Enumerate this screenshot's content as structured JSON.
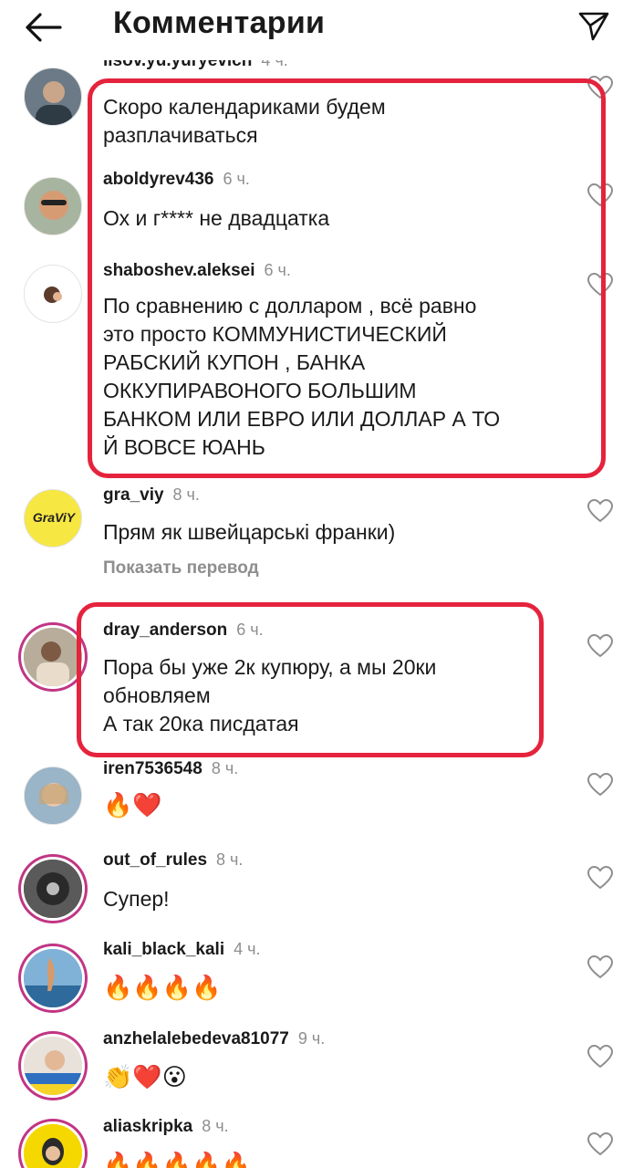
{
  "header": {
    "title": "Комментарии"
  },
  "cut_comment": {
    "username": "lisov.yu.yuryevich",
    "time": "4 ч.",
    "text": "Скоро календариками будем\nразплачиваться"
  },
  "comments": [
    {
      "username": "aboldyrev436",
      "time": "6 ч.",
      "text": "Ох и г**** не двадцатка"
    },
    {
      "username": "shaboshev.aleksei",
      "time": "6 ч.",
      "text": "По сравнению с долларом , всё равно\nэто просто КОММУНИСТИЧЕСКИЙ\nРАБСКИЙ КУПОН , БАНКА\nОККУПИРАВОНОГО БОЛЬШИМ\nБАНКОМ ИЛИ ЕВРО ИЛИ ДОЛЛАР А ТО\nЙ ВОВСЕ ЮАНЬ"
    },
    {
      "username": "gra_viy",
      "time": "8 ч.",
      "text": "Прям як швейцарські франки)",
      "translate": "Показать перевод",
      "avatar_text": "GraViY"
    },
    {
      "username": "dray_anderson",
      "time": "6 ч.",
      "text": "Пора бы уже 2к купюру, а мы 20ки\nобновляем\nА так 20ка писдатая"
    },
    {
      "username": "iren7536548",
      "time": "8 ч.",
      "text": "🔥❤️"
    },
    {
      "username": "out_of_rules",
      "time": "8 ч.",
      "text": "Супер!"
    },
    {
      "username": "kali_black_kali",
      "time": "4 ч.",
      "text": "🔥🔥🔥🔥"
    },
    {
      "username": "anzhelalebedeva81077",
      "time": "9 ч.",
      "text": "👏❤️😮"
    },
    {
      "username": "aliaskripka",
      "time": "8 ч.",
      "text": "🔥🔥🔥🔥🔥"
    }
  ],
  "colors": {
    "highlight": "#e5233d",
    "story_ring": "#c13584",
    "secondary_text": "#8e8e8e"
  }
}
